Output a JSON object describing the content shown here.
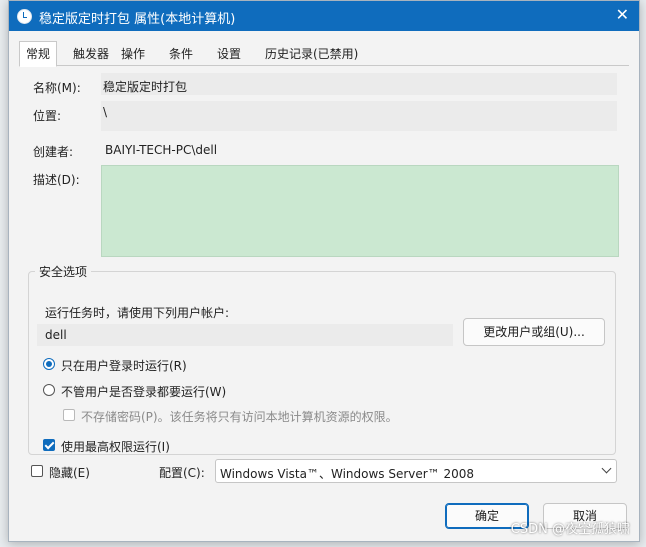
{
  "window": {
    "title": "稳定版定时打包 属性(本地计算机)",
    "close_glyph": "✕"
  },
  "tabs": [
    {
      "label": "常规"
    },
    {
      "label": "触发器"
    },
    {
      "label": "操作"
    },
    {
      "label": "条件"
    },
    {
      "label": "设置"
    },
    {
      "label": "历史记录(已禁用)"
    }
  ],
  "general": {
    "name_label": "名称(M):",
    "name_value": "稳定版定时打包",
    "location_label": "位置:",
    "location_value": "\\",
    "author_label": "创建者:",
    "author_value": "BAIYI-TECH-PC\\dell",
    "description_label": "描述(D):",
    "description_value": ""
  },
  "security": {
    "legend": "安全选项",
    "run_as_label": "运行任务时，请使用下列用户帐户:",
    "user_value": "dell",
    "change_user_button": "更改用户或组(U)...",
    "option_logged_on": "只在用户登录时运行(R)",
    "option_whether_logged_on": "不管用户是否登录都要运行(W)",
    "do_not_store_password": "不存储密码(P)。该任务将只有访问本地计算机资源的权限。",
    "run_highest": "使用最高权限运行(I)"
  },
  "bottom": {
    "hidden_label": "隐藏(E)",
    "configure_label": "配置(C):",
    "configure_value": "Windows Vista™、Windows Server™ 2008"
  },
  "buttons": {
    "ok": "确定",
    "cancel": "取消"
  },
  "watermark": "CSDN @夜空孤狼啸",
  "colors": {
    "titlebar": "#0f6cbd",
    "accent": "#0f6cbd",
    "description_bg": "#cbe8d1"
  }
}
